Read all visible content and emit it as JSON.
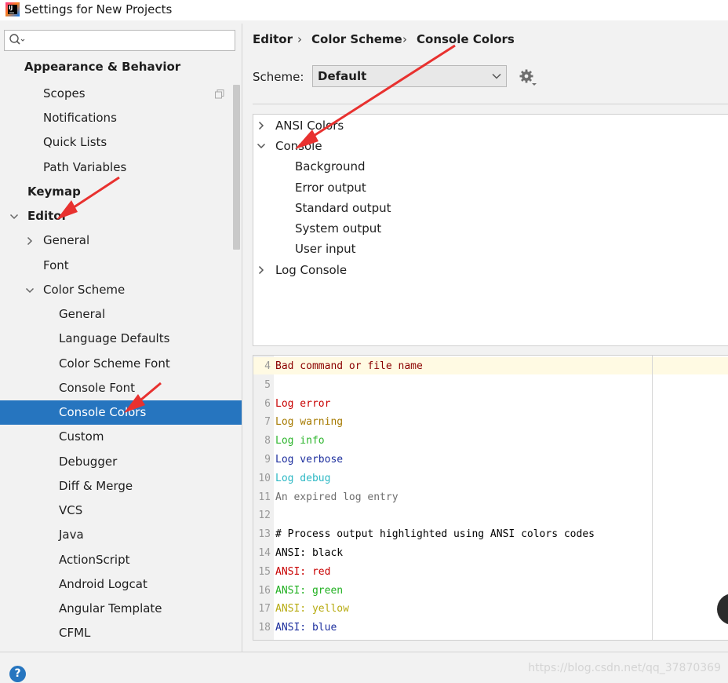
{
  "window": {
    "title": "Settings for New Projects"
  },
  "search": {
    "placeholder": "",
    "value": ""
  },
  "nav": {
    "appearance_behavior": "Appearance & Behavior",
    "scopes": "Scopes",
    "notifications": "Notifications",
    "quick_lists": "Quick Lists",
    "path_variables": "Path Variables",
    "keymap": "Keymap",
    "editor": "Editor",
    "general": "General",
    "font": "Font",
    "color_scheme": "Color Scheme",
    "cs_general": "General",
    "language_defaults": "Language Defaults",
    "color_scheme_font": "Color Scheme Font",
    "console_font": "Console Font",
    "console_colors": "Console Colors",
    "custom": "Custom",
    "debugger": "Debugger",
    "diff_merge": "Diff & Merge",
    "vcs": "VCS",
    "java": "Java",
    "actionscript": "ActionScript",
    "android_logcat": "Android Logcat",
    "angular_template": "Angular Template",
    "cfml": "CFML"
  },
  "breadcrumb": {
    "editor": "Editor",
    "color_scheme": "Color Scheme",
    "console_colors": "Console Colors",
    "separator": "›"
  },
  "scheme": {
    "label": "Scheme:",
    "value": "Default"
  },
  "tree": {
    "ansi_colors": "ANSI Colors",
    "console": "Console",
    "background": "Background",
    "error_output": "Error output",
    "standard_output": "Standard output",
    "system_output": "System output",
    "user_input": "User input",
    "log_console": "Log Console"
  },
  "preview": {
    "lines": [
      {
        "num": "4",
        "text": "Bad command or file name",
        "color": "#8b0000"
      },
      {
        "num": "5",
        "text": "",
        "color": "#000000"
      },
      {
        "num": "6",
        "text": "Log error",
        "color": "#c80000"
      },
      {
        "num": "7",
        "text": "Log warning",
        "color": "#a67a00"
      },
      {
        "num": "8",
        "text": "Log info",
        "color": "#2db52d"
      },
      {
        "num": "9",
        "text": "Log verbose",
        "color": "#1d2f9e"
      },
      {
        "num": "10",
        "text": "Log debug",
        "color": "#2db8c4"
      },
      {
        "num": "11",
        "text": "An expired log entry",
        "color": "#6e6e6e"
      },
      {
        "num": "12",
        "text": "",
        "color": "#000000"
      },
      {
        "num": "13",
        "text": "# Process output highlighted using ANSI colors codes",
        "color": "#000000"
      },
      {
        "num": "14",
        "text": "ANSI: black",
        "color": "#000000"
      },
      {
        "num": "15",
        "text": "ANSI: red",
        "color": "#c80000"
      },
      {
        "num": "16",
        "text": "ANSI: green",
        "color": "#21b021"
      },
      {
        "num": "17",
        "text": "ANSI: yellow",
        "color": "#b7ab11"
      },
      {
        "num": "18",
        "text": "ANSI: blue",
        "color": "#1d2f9e"
      }
    ]
  },
  "footer": {
    "help": "?",
    "watermark": "https://blog.csdn.net/qq_37870369"
  },
  "colors": {
    "selection": "#2675bf",
    "annotation_arrow": "#e8312f"
  },
  "icons": [
    "app-icon",
    "search-icon",
    "copy-icon",
    "chevron-right-icon",
    "chevron-down-icon",
    "dropdown-icon",
    "gear-icon",
    "help-icon"
  ]
}
